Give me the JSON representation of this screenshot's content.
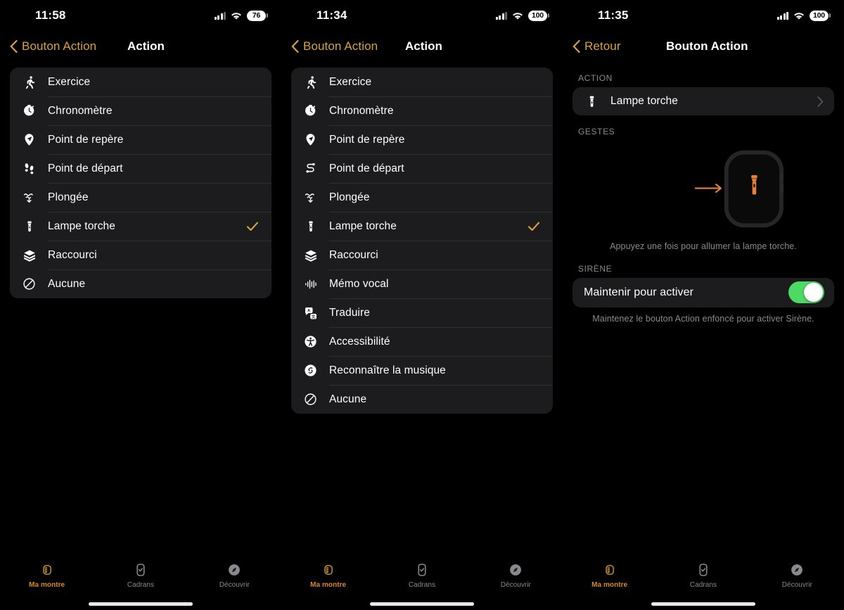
{
  "panels": [
    {
      "status": {
        "time": "11:58",
        "battery": "76",
        "signal_bars": 3,
        "wifi": true
      },
      "nav": {
        "back_label": "Bouton Action",
        "title": "Action",
        "back_icon": "chevron-left-icon"
      },
      "list": [
        {
          "icon": "running-person-icon",
          "label": "Exercice",
          "checked": false
        },
        {
          "icon": "stopwatch-icon",
          "label": "Chronomètre",
          "checked": false
        },
        {
          "icon": "waypoint-icon",
          "label": "Point de repère",
          "checked": false
        },
        {
          "icon": "footprints-icon",
          "label": "Point de départ",
          "checked": false
        },
        {
          "icon": "dive-waves-icon",
          "label": "Plongée",
          "checked": false
        },
        {
          "icon": "flashlight-icon",
          "label": "Lampe torche",
          "checked": true
        },
        {
          "icon": "shortcut-layers-icon",
          "label": "Raccourci",
          "checked": false
        },
        {
          "icon": "none-slash-circle-icon",
          "label": "Aucune",
          "checked": false
        }
      ],
      "tabs": [
        {
          "label": "Ma montre",
          "icon": "watch-icon",
          "active": true
        },
        {
          "label": "Cadrans",
          "icon": "watch-face-icon",
          "active": false
        },
        {
          "label": "Découvrir",
          "icon": "compass-icon",
          "active": false
        }
      ]
    },
    {
      "status": {
        "time": "11:34",
        "battery": "100",
        "signal_bars": 3,
        "wifi": true
      },
      "nav": {
        "back_label": "Bouton Action",
        "title": "Action",
        "back_icon": "chevron-left-icon"
      },
      "list": [
        {
          "icon": "running-person-icon",
          "label": "Exercice",
          "checked": false
        },
        {
          "icon": "stopwatch-icon",
          "label": "Chronomètre",
          "checked": false
        },
        {
          "icon": "waypoint-icon",
          "label": "Point de repère",
          "checked": false
        },
        {
          "icon": "route-s-icon",
          "label": "Point de départ",
          "checked": false
        },
        {
          "icon": "dive-waves-icon",
          "label": "Plongée",
          "checked": false
        },
        {
          "icon": "flashlight-icon",
          "label": "Lampe torche",
          "checked": true
        },
        {
          "icon": "shortcut-layers-icon",
          "label": "Raccourci",
          "checked": false
        },
        {
          "icon": "waveform-icon",
          "label": "Mémo vocal",
          "checked": false
        },
        {
          "icon": "translate-icon",
          "label": "Traduire",
          "checked": false
        },
        {
          "icon": "accessibility-icon",
          "label": "Accessibilité",
          "checked": false
        },
        {
          "icon": "shazam-icon",
          "label": "Reconnaître la musique",
          "checked": false
        },
        {
          "icon": "none-slash-circle-icon",
          "label": "Aucune",
          "checked": false
        }
      ],
      "tabs": [
        {
          "label": "Ma montre",
          "icon": "watch-icon",
          "active": true
        },
        {
          "label": "Cadrans",
          "icon": "watch-face-icon",
          "active": false
        },
        {
          "label": "Découvrir",
          "icon": "compass-icon",
          "active": false
        }
      ]
    },
    {
      "status": {
        "time": "11:35",
        "battery": "100",
        "signal_bars": 3,
        "wifi": true
      },
      "nav": {
        "back_label": "Retour",
        "title": "Bouton Action",
        "back_icon": "chevron-left-icon"
      },
      "sections": {
        "action": {
          "header": "ACTION",
          "row": {
            "icon": "flashlight-icon",
            "label": "Lampe torche",
            "chevron": "chevron-right-icon"
          }
        },
        "gestures": {
          "header": "GESTES",
          "illustration": "apple-watch-action-button-illustration",
          "caption": "Appuyez une fois pour allumer la lampe torche."
        },
        "siren": {
          "header": "SIRÈNE",
          "toggle_label": "Maintenir pour activer",
          "toggle_on": true,
          "footer": "Maintenez le bouton Action enfoncé pour activer Sirène."
        }
      },
      "tabs": [
        {
          "label": "Ma montre",
          "icon": "watch-icon",
          "active": true
        },
        {
          "label": "Cadrans",
          "icon": "watch-face-icon",
          "active": false
        },
        {
          "label": "Découvrir",
          "icon": "compass-icon",
          "active": false
        }
      ]
    }
  ],
  "colors": {
    "accent_gold": "#D9A23E",
    "accent_orange": "#D9892E",
    "toggle_green": "#4CD964",
    "card_bg": "#1C1C1E",
    "secondary_text": "#8A8A8E",
    "illustration_orange": "#E8803A"
  }
}
